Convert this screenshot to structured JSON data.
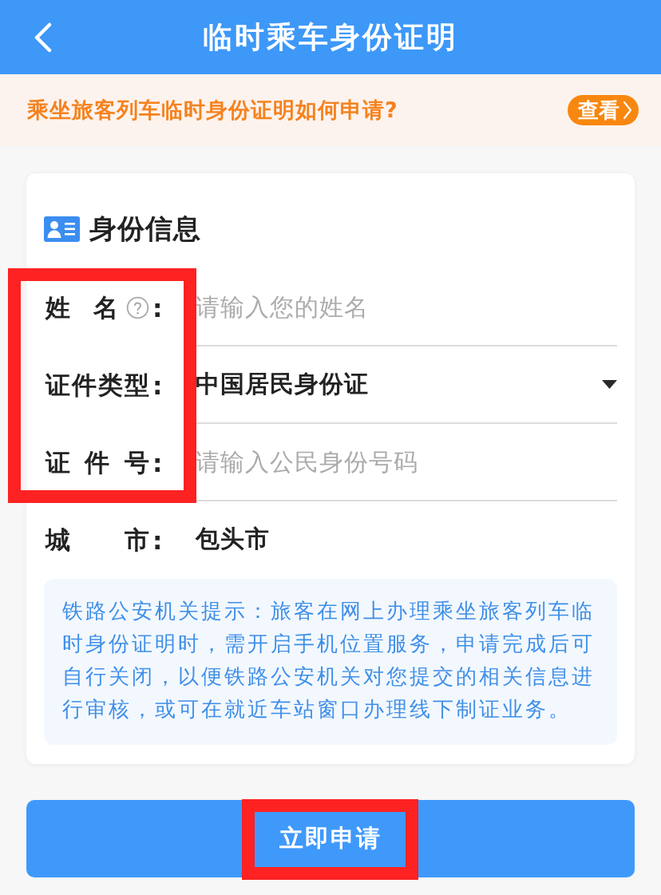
{
  "header": {
    "title": "临时乘车身份证明"
  },
  "notice": {
    "text": "乘坐旅客列车临时身份证明如何申请?",
    "link": "查看"
  },
  "card": {
    "title": "身份信息",
    "rows": [
      {
        "kind": "input",
        "label": "姓 名",
        "help": true,
        "colon": ":",
        "placeholder": "请输入您的姓名",
        "highlighted": true
      },
      {
        "kind": "select",
        "label": "证件类型",
        "help": false,
        "colon": ":",
        "value": "中国居民身份证",
        "highlighted": true
      },
      {
        "kind": "input",
        "label": "证 件 号",
        "help": false,
        "colon": ":",
        "placeholder": "请输入公民身份号码",
        "highlighted": true
      },
      {
        "kind": "text",
        "label": "城 市",
        "help": false,
        "colon": ":",
        "value": "包头市",
        "highlighted": false
      }
    ],
    "tip": "铁路公安机关提示：旅客在网上办理乘坐旅客列车临时身份证明时，需开启手机位置服务，申请完成后可自行关闭，以便铁路公安机关对您提交的相关信息进行审核，或可在就近车站窗口办理线下制证业务。"
  },
  "submit": {
    "label": "立即申请",
    "highlighted": true
  }
}
